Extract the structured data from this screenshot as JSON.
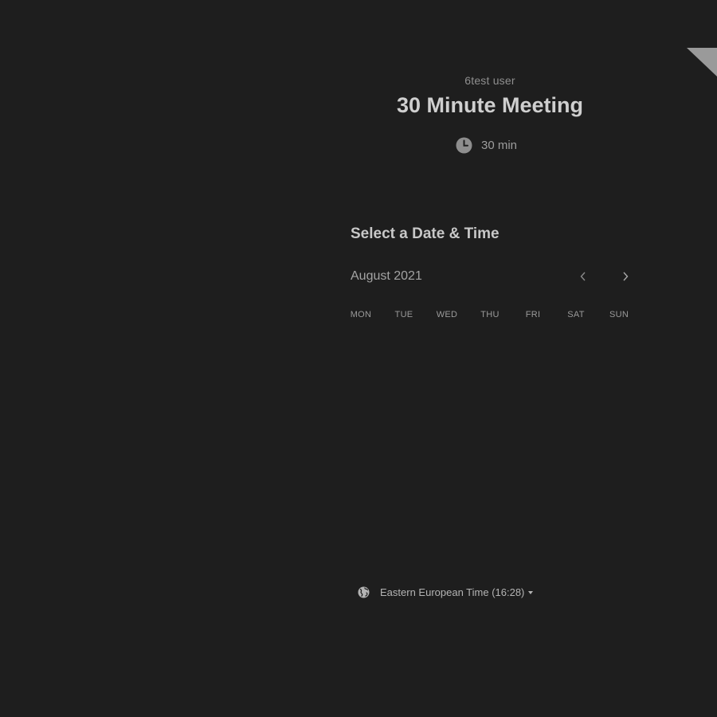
{
  "event": {
    "host": "6test user",
    "title": "30 Minute Meeting",
    "duration": "30 min",
    "duration_icon": "clock-icon"
  },
  "calendar": {
    "section_title": "Select a Date & Time",
    "month": "August 2021",
    "prev_icon": "chevron-left-icon",
    "next_icon": "chevron-right-icon",
    "weekdays": [
      "MON",
      "TUE",
      "WED",
      "THU",
      "FRI",
      "SAT",
      "SUN"
    ]
  },
  "timezone": {
    "label": "Eastern European Time (16:28)",
    "icon": "globe-icon"
  },
  "colors": {
    "background": "#1e1e1e",
    "ribbon": "#9a9a9a"
  }
}
